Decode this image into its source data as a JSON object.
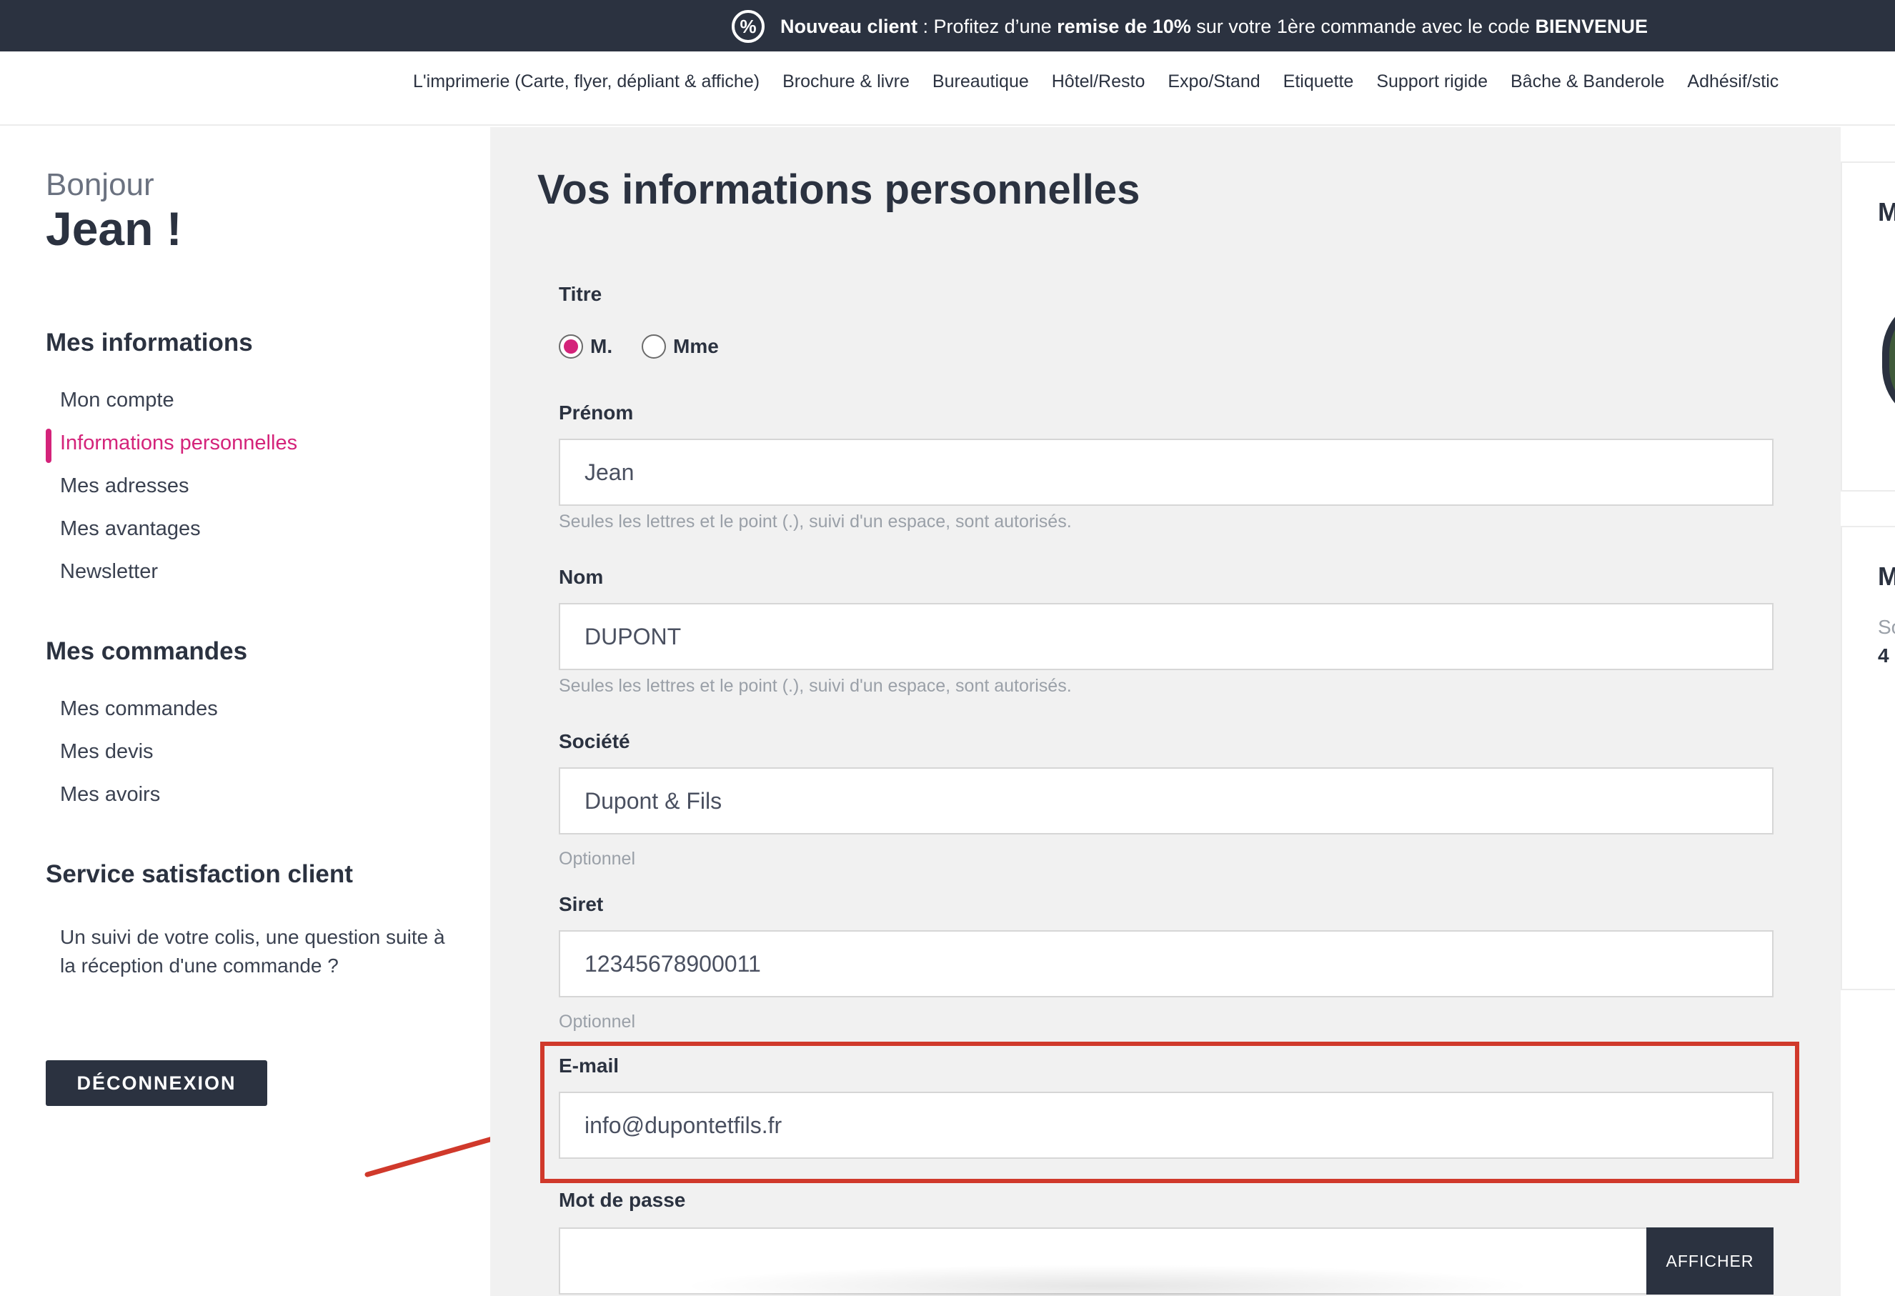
{
  "promo": {
    "icon": "discount-icon",
    "icon_glyph": "%",
    "part1_bold": "Nouveau client",
    "part2": " : Profitez d’une ",
    "part3_bold": "remise de 10%",
    "part4": " sur votre 1ère commande avec le code ",
    "part5_bold": "BIENVENUE"
  },
  "nav": {
    "items": [
      "L'imprimerie (Carte, flyer, dépliant & affiche)",
      "Brochure & livre",
      "Bureautique",
      "Hôtel/Resto",
      "Expo/Stand",
      "Etiquette",
      "Support rigide",
      "Bâche & Banderole",
      "Adhésif/stic"
    ]
  },
  "sidebar": {
    "greeting_small": "Bonjour",
    "greeting_big": "Jean !",
    "section1_title": "Mes informations",
    "section1_links": [
      "Mon compte",
      "Informations personnelles",
      "Mes adresses",
      "Mes avantages",
      "Newsletter"
    ],
    "section2_title": "Mes commandes",
    "section2_links": [
      "Mes commandes",
      "Mes devis",
      "Mes avoirs"
    ],
    "section3_title": "Service satisfaction client",
    "section3_text": "Un suivi de votre colis, une question suite à la réception d'une commande ?",
    "logout_label": "DÉCONNEXION"
  },
  "main": {
    "title": "Vos informations personnelles",
    "titre_label": "Titre",
    "radio_m": "M.",
    "radio_mme": "Mme",
    "prenom_label": "Prénom",
    "prenom_value": "Jean",
    "prenom_hint": "Seules les lettres et le point (.), suivi d'un espace, sont autorisés.",
    "nom_label": "Nom",
    "nom_value": "DUPONT",
    "nom_hint": "Seules les lettres et le point (.), suivi d'un espace, sont autorisés.",
    "societe_label": "Société",
    "societe_value": "Dupont & Fils",
    "societe_hint": "Optionnel",
    "siret_label": "Siret",
    "siret_value": "12345678900011",
    "siret_hint": "Optionnel",
    "email_label": "E-mail",
    "email_value": "info@dupontetfils.fr",
    "password_label": "Mot de passe",
    "password_value": "",
    "password_button": "AFFICHER"
  },
  "right": {
    "card1_letter": "M",
    "card2_letter": "M",
    "card2_small": "So",
    "card2_num": "4"
  },
  "colors": {
    "accent": "#d4237a",
    "dark": "#2b3240",
    "highlight": "#d0392b"
  }
}
